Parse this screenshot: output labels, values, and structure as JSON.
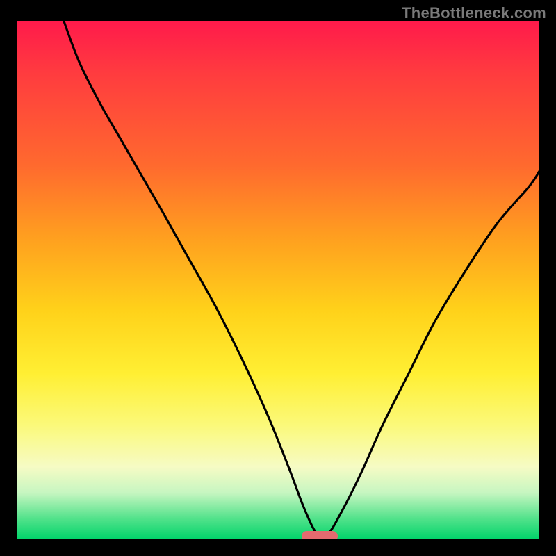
{
  "watermark": "TheBottleneck.com",
  "colors": {
    "background": "#000000",
    "curve": "#000000",
    "marker": "#e46a6f",
    "gradient_stops": [
      "#ff1a4b",
      "#ff3b3f",
      "#ff6a2e",
      "#ffa01f",
      "#ffd21a",
      "#ffef33",
      "#fbf97a",
      "#f6fbc4",
      "#c7f6c1",
      "#52e28b",
      "#00d46a"
    ]
  },
  "chart_data": {
    "type": "line",
    "title": "",
    "xlabel": "",
    "ylabel": "",
    "xlim": [
      0,
      100
    ],
    "ylim": [
      0,
      100
    ],
    "grid": false,
    "legend": false,
    "notes": "V-shaped bottleneck curve over red-to-green vertical gradient; minimum marked with a small rounded pill near the bottom.",
    "min_marker": {
      "x": 58,
      "y": 0.5,
      "width_pct": 7
    },
    "series": [
      {
        "name": "bottleneck-curve",
        "x": [
          9,
          12,
          16,
          20,
          24,
          28,
          33,
          38,
          43,
          48,
          52,
          55,
          57.5,
          59.5,
          62,
          66,
          70,
          75,
          80,
          86,
          92,
          98,
          100
        ],
        "y": [
          100,
          92,
          84,
          77,
          70,
          63,
          54,
          45,
          35,
          24,
          14,
          6,
          1,
          1,
          5,
          13,
          22,
          32,
          42,
          52,
          61,
          68,
          71
        ]
      }
    ]
  }
}
